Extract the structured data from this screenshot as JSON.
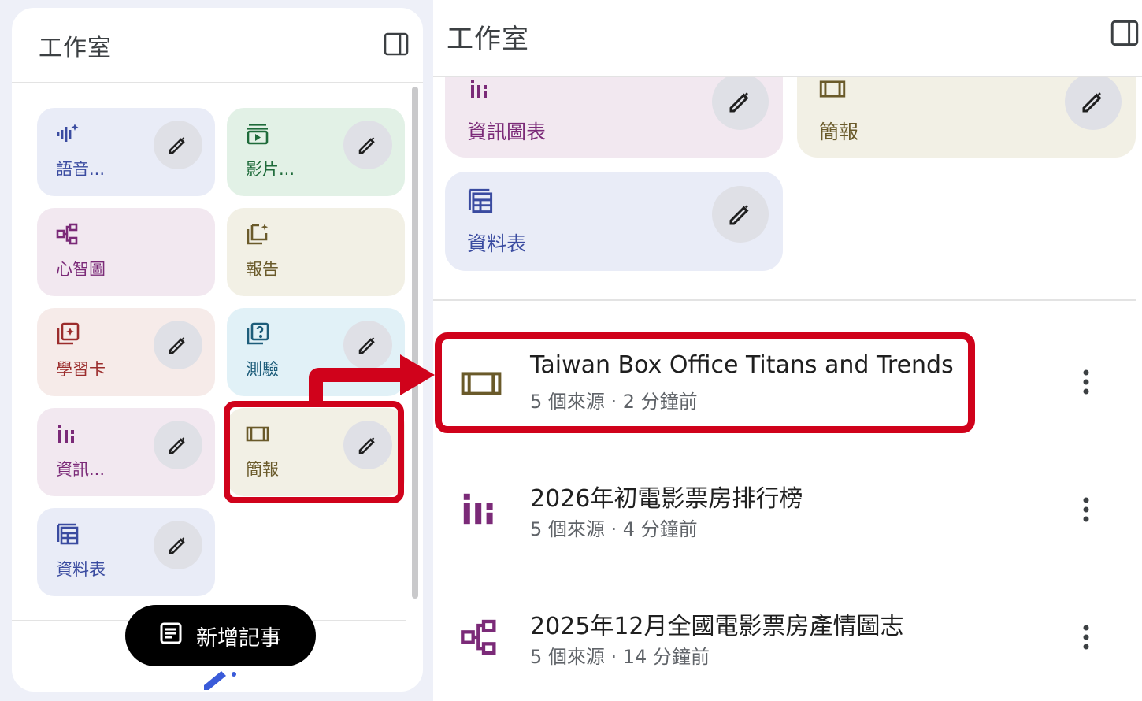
{
  "left_panel": {
    "title": "工作室",
    "new_note_label": "新增記事",
    "tiles": [
      {
        "label": "語音...",
        "icon": "audio-wave-icon"
      },
      {
        "label": "影片...",
        "icon": "video-icon"
      },
      {
        "label": "心智圖",
        "icon": "mind-map-icon"
      },
      {
        "label": "報告",
        "icon": "report-icon"
      },
      {
        "label": "學習卡",
        "icon": "flashcard-icon"
      },
      {
        "label": "測驗",
        "icon": "quiz-icon"
      },
      {
        "label": "資訊...",
        "icon": "infographic-icon"
      },
      {
        "label": "簡報",
        "icon": "slides-icon"
      },
      {
        "label": "資料表",
        "icon": "data-table-icon"
      }
    ]
  },
  "right_panel": {
    "title": "工作室",
    "tiles": [
      {
        "label": "資訊圖表",
        "icon": "infographic-icon"
      },
      {
        "label": "簡報",
        "icon": "slides-icon"
      },
      {
        "label": "資料表",
        "icon": "data-table-icon"
      }
    ],
    "notes": [
      {
        "title": "Taiwan Box Office Titans and Trends",
        "meta": "5 個來源 · 2 分鐘前",
        "icon": "slides-icon"
      },
      {
        "title": "2026年初電影票房排行榜",
        "meta": "5 個來源 · 4 分鐘前",
        "icon": "infographic-icon"
      },
      {
        "title": "2025年12月全國電影票房產情圖志",
        "meta": "5 個來源 · 14 分鐘前",
        "icon": "mind-map-icon"
      }
    ]
  },
  "colors": {
    "audio_tile": "#e9ecf7",
    "video_tile": "#e2f1e6",
    "mindmap_tile": "#f2e8f0",
    "report_tile": "#f2f0e5",
    "flashcard_tile": "#f6ebe9",
    "quiz_tile": "#e1f1f7",
    "info_tile": "#f2e8f0",
    "slides_tile": "#f2f0e5",
    "table_tile": "#e9ecf7",
    "highlight": "#d0021b"
  }
}
